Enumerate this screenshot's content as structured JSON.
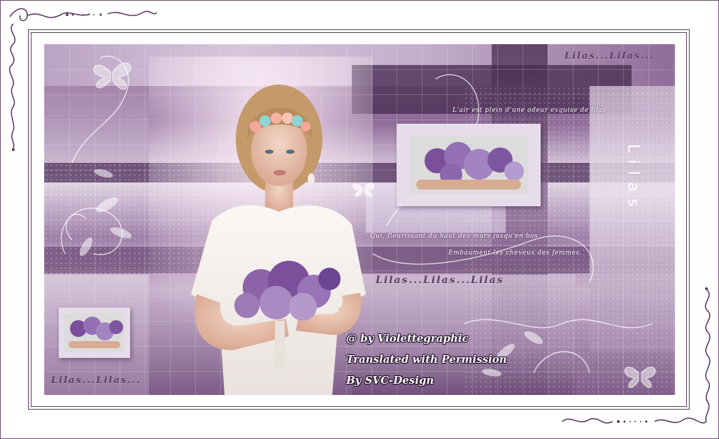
{
  "texts": {
    "lilas_top_right": "Lilas...Lilas...",
    "lilas_middle": "Lilas...Lilas...Lilas",
    "lilas_bottom_left": "Lilas...Lilas...",
    "vertical_title": "Lilas"
  },
  "poem": {
    "line1": "L'air est plein d'une odeur exquise de lilas",
    "line2": "Qui, fleurissant du haut des murs jusqu'en bas",
    "line3": "Embaument les cheveux des femmes."
  },
  "credits": {
    "line1": "@ by Violettegraphic",
    "line2": "Translated with Permission",
    "line3": "By SVC-Design"
  },
  "colors": {
    "frame": "#5a3d5e",
    "lilac_dark": "#6f4c7a",
    "lilac_mid": "#a586ad",
    "lilac_light": "#e3d6e6"
  }
}
